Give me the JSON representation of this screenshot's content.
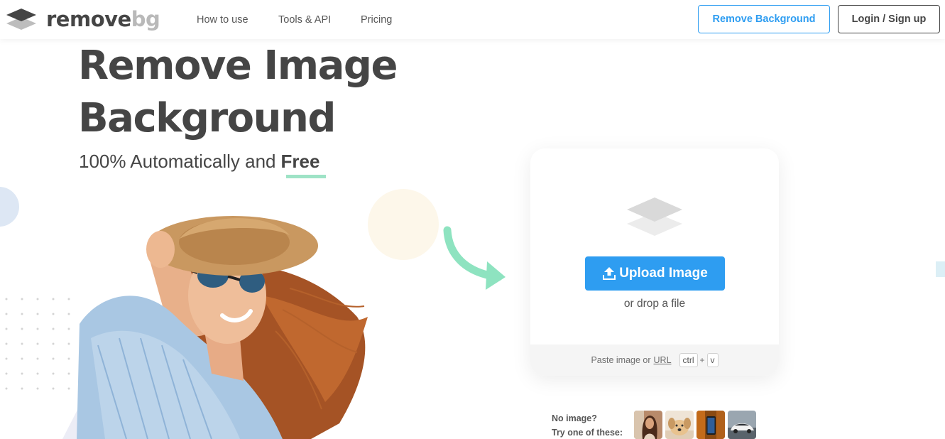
{
  "brand": {
    "word_dark": "remove",
    "word_light": "bg"
  },
  "nav": {
    "how_to_use": "How to use",
    "tools_api": "Tools & API",
    "pricing": "Pricing",
    "remove_background": "Remove Background",
    "login_signup": "Login / Sign up"
  },
  "hero": {
    "title_line1": "Remove Image",
    "title_line2": "Background",
    "subtitle_prefix": "100% Automatically and",
    "subtitle_emphasis": "Free"
  },
  "upload": {
    "button_label": "Upload Image",
    "drop_text": "or drop a file",
    "paste_text": "Paste image or",
    "url_link": "URL",
    "key_ctrl": "ctrl",
    "key_plus": "+",
    "key_v": "v"
  },
  "samples": {
    "line1": "No image?",
    "line2": "Try one of these:",
    "items": [
      "woman-portrait",
      "dog",
      "phone",
      "car"
    ]
  },
  "colors": {
    "accent_blue": "#2e9df1",
    "text_dark": "#454545",
    "underline_green": "#9ee3c6",
    "arrow_green": "#8ee3c0"
  }
}
